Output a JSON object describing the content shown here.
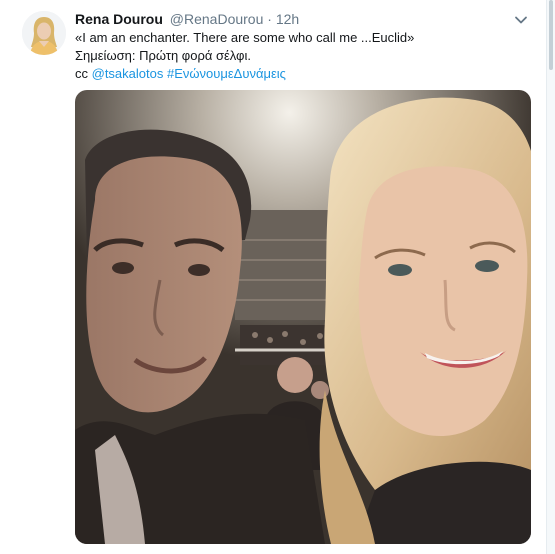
{
  "tweet": {
    "name": "Rena Dourou",
    "handle": "@RenaDourou",
    "separator": "·",
    "time": "12h",
    "line1": "«I am an enchanter. There are some who call me ...Euclid»",
    "line2": "Σημείωση: Πρώτη φορά σέλφι.",
    "cc_prefix": "cc",
    "mention": "@tsakalotos",
    "hashtag": "#ΕνώνουμεΔυνάμεις"
  },
  "icons": {
    "menu": "chevron-down-icon",
    "avatar": "profile-avatar",
    "photo": "selfie-photo"
  },
  "colors": {
    "link": "#1b95e0",
    "secondary_text": "#657786",
    "primary_text": "#14171a",
    "background": "#e6ecf0"
  }
}
